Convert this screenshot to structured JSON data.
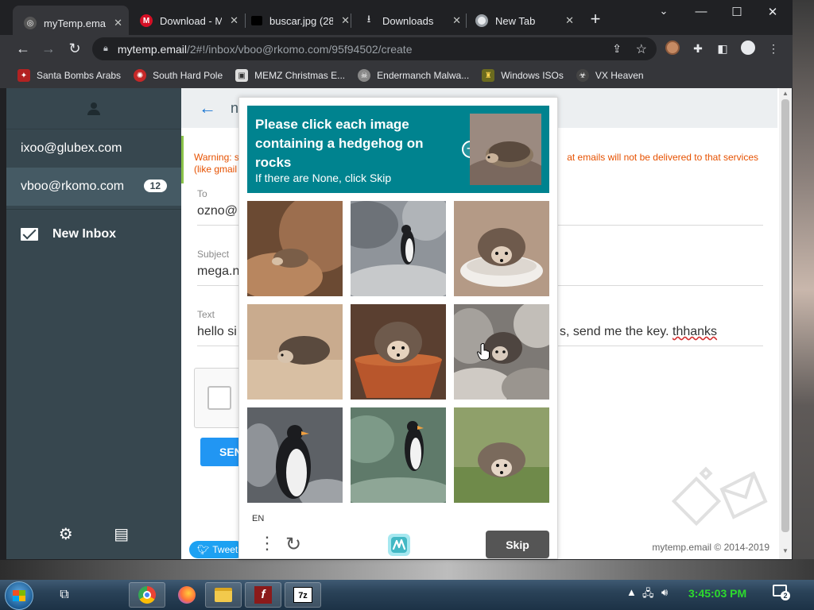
{
  "browser": {
    "tabs": [
      {
        "title": "myTemp.email",
        "active": true
      },
      {
        "title": "Download - M",
        "active": false
      },
      {
        "title": "buscar.jpg (28",
        "active": false
      },
      {
        "title": "Downloads",
        "active": false
      },
      {
        "title": "New Tab",
        "active": false
      }
    ],
    "url_host": "mytemp.email",
    "url_path": "/2#!/inbox/vboo@rkomo.com/95f94502/create",
    "bookmarks": [
      {
        "label": "Santa Bombs Arabs",
        "icon": "santa-icon"
      },
      {
        "label": "South Hard Pole",
        "icon": "virus-icon"
      },
      {
        "label": "MEMZ Christmas E...",
        "icon": "image-icon"
      },
      {
        "label": "Endermanch Malwa...",
        "icon": "skull-icon"
      },
      {
        "label": "Windows ISOs",
        "icon": "folder-icon"
      },
      {
        "label": "VX Heaven",
        "icon": "vx-icon"
      }
    ]
  },
  "sidebar": {
    "accounts": [
      {
        "email": "ixoo@glubex.com",
        "selected": false,
        "badge": ""
      },
      {
        "email": "vboo@rkomo.com",
        "selected": true,
        "badge": "12"
      }
    ],
    "new_inbox": "New Inbox"
  },
  "compose": {
    "header_partial": "n",
    "warning_left": "Warning: s",
    "warning_left2": "(like gmail",
    "warning_right": "at emails will not be delivered to that services",
    "to_label": "To",
    "to_value": "ozno@",
    "subject_label": "Subject",
    "subject_value": "mega.n",
    "text_label": "Text",
    "text_value_left": "hello si",
    "text_value_right": "s, send me the key.",
    "text_value_misspelled": "thhanks",
    "send_label": "SEN",
    "tweet_label": "Tweet",
    "copyright": "mytemp.email © 2014-2019"
  },
  "hcaptcha": {
    "prompt_line": "Please click each image containing a hedgehog on rocks",
    "sub": "If there are None, click Skip",
    "lang": "EN",
    "skip": "Skip",
    "images": [
      {
        "subject": "hedgehog",
        "scene": "rocks-brown"
      },
      {
        "subject": "penguin",
        "scene": "rocks-grey"
      },
      {
        "subject": "hedgehog",
        "scene": "bowl-white"
      },
      {
        "subject": "hedgehog",
        "scene": "sand"
      },
      {
        "subject": "hedgehog",
        "scene": "bowl-orange"
      },
      {
        "subject": "hedgehog",
        "scene": "rocks-grey"
      },
      {
        "subject": "penguin",
        "scene": "rocks-dark"
      },
      {
        "subject": "penguin",
        "scene": "rocks-green"
      },
      {
        "subject": "hedgehog",
        "scene": "grass"
      }
    ]
  },
  "taskbar": {
    "clock": "3:45:03 PM",
    "notifications": "2",
    "apps": [
      "chrome-icon",
      "firefox-icon",
      "explorer-icon",
      "flash-icon",
      "7zip-icon"
    ]
  },
  "colors": {
    "sidebar": "#37474f",
    "captcha_teal": "#00838f",
    "send_blue": "#2196f3",
    "warning_orange": "#e65100",
    "clock_green": "#2ddc2d"
  }
}
